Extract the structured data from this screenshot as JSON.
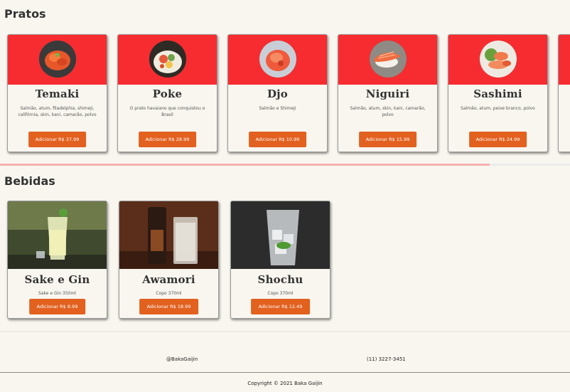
{
  "sections": {
    "pratos_title": "Pratos",
    "bebidas_title": "Bebidas"
  },
  "dishes": [
    {
      "name": "Temaki",
      "desc": "Salmão, atum, filadelphia, shimeji, califórnia, skin, kani, camarão, polvo",
      "button": "Adicionar R$ 37.99",
      "image": "temaki-photo"
    },
    {
      "name": "Poke",
      "desc": "O prato havaiano que conquistou o Brasil",
      "button": "Adicionar R$ 28.99",
      "image": "poke-photo"
    },
    {
      "name": "Djo",
      "desc": "Salmão e Shimeji",
      "button": "Adicionar R$ 10.99",
      "image": "djo-photo"
    },
    {
      "name": "Niguiri",
      "desc": "Salmão, atum, skin, kani, camarão, polvo",
      "button": "Adicionar R$ 15.99",
      "image": "niguiri-photo"
    },
    {
      "name": "Sashimi",
      "desc": "Salmão, atum, peixe branco, polvo",
      "button": "Adicionar R$ 24.99",
      "image": "sashimi-photo"
    }
  ],
  "drinks": [
    {
      "name": "Sake e Gin",
      "desc": "Sake e Gin 350ml",
      "button": "Adicionar R$ 8.99",
      "image": "sake-gin-photo"
    },
    {
      "name": "Awamori",
      "desc": "Copo 370ml",
      "button": "Adicionar R$ 18.99",
      "image": "awamori-photo"
    },
    {
      "name": "Shochu",
      "desc": "Copo 370ml",
      "button": "Adicionar R$ 12.49",
      "image": "shochu-photo"
    }
  ],
  "footer": {
    "social": "@BakaGaijin",
    "phone": "(11) 3227-3451",
    "copyright": "Copyright © 2021 Baka Gaijin"
  },
  "colors": {
    "banner": "#f62c30",
    "button": "#e2611f",
    "background": "#f8f6ef",
    "scroll_thumb": "#f6b0b0"
  }
}
